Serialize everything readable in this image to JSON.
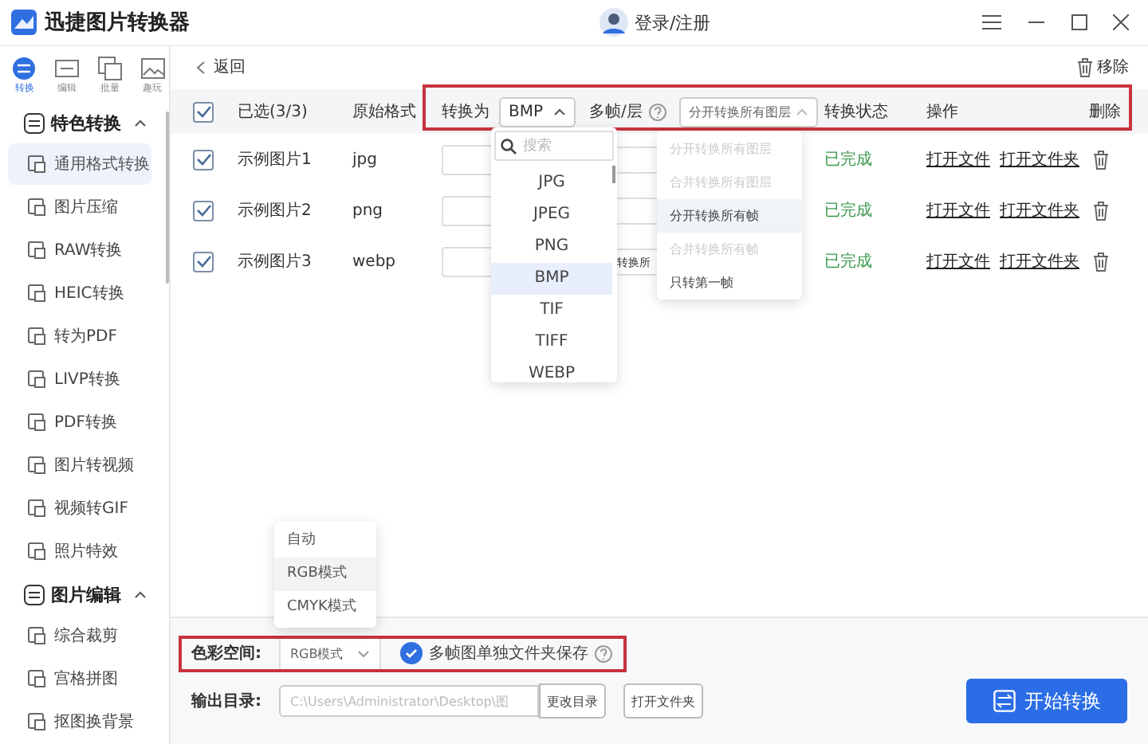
{
  "window": {
    "title": "迅捷图片转换器",
    "login": "登录/注册"
  },
  "sidebar": {
    "modes": [
      {
        "label": "转换",
        "selected": true
      },
      {
        "label": "编辑",
        "selected": false
      },
      {
        "label": "批量",
        "selected": false
      },
      {
        "label": "趣玩",
        "selected": false
      }
    ],
    "sections": [
      {
        "title": "特色转换",
        "expanded": true,
        "items": [
          {
            "label": "通用格式转换",
            "selected": true
          },
          {
            "label": "图片压缩",
            "selected": false
          },
          {
            "label": "RAW转换",
            "selected": false
          },
          {
            "label": "HEIC转换",
            "selected": false
          },
          {
            "label": "转为PDF",
            "selected": false
          },
          {
            "label": "LIVP转换",
            "selected": false
          },
          {
            "label": "PDF转换",
            "selected": false
          },
          {
            "label": "图片转视频",
            "selected": false
          },
          {
            "label": "视频转GIF",
            "selected": false
          },
          {
            "label": "照片特效",
            "selected": false
          }
        ]
      },
      {
        "title": "图片编辑",
        "expanded": true,
        "items": [
          {
            "label": "综合裁剪",
            "selected": false
          },
          {
            "label": "宫格拼图",
            "selected": false
          },
          {
            "label": "抠图换背景",
            "selected": false
          }
        ]
      }
    ]
  },
  "toolbar": {
    "back": "返回",
    "remove": "移除"
  },
  "table": {
    "select_all": {
      "label": "已选(3/3)",
      "checked": true
    },
    "source_format": "原始格式",
    "convert_to": "转换为",
    "target": "BMP",
    "multi_frame": "多帧/层",
    "frame_mode": "分开转换所有图层",
    "status": "转换状态",
    "actions": "操作",
    "delete": "删除",
    "rows": [
      {
        "checked": true,
        "name": "示例图片1",
        "format": "jpg",
        "status": "已完成",
        "open_file": "打开文件",
        "open_folder": "打开文件夹"
      },
      {
        "checked": true,
        "name": "示例图片2",
        "format": "png",
        "status": "已完成",
        "open_file": "打开文件",
        "open_folder": "打开文件夹"
      },
      {
        "checked": true,
        "name": "示例图片3",
        "format": "webp",
        "frame_value": "转换所",
        "status": "已完成",
        "open_file": "打开文件",
        "open_folder": "打开文件夹"
      }
    ]
  },
  "format_menu": {
    "placeholder": "搜索",
    "options": [
      {
        "label": "JPG",
        "selected": false
      },
      {
        "label": "JPEG",
        "selected": false
      },
      {
        "label": "PNG",
        "selected": false
      },
      {
        "label": "BMP",
        "selected": true
      },
      {
        "label": "TIF",
        "selected": false
      },
      {
        "label": "TIFF",
        "selected": false
      },
      {
        "label": "WEBP",
        "selected": false
      }
    ]
  },
  "frame_menu": {
    "options": [
      {
        "label": "分开转换所有图层",
        "disabled": true,
        "selected": false
      },
      {
        "label": "合并转换所有图层",
        "disabled": true,
        "selected": false
      },
      {
        "label": "分开转换所有帧",
        "disabled": false,
        "selected": true
      },
      {
        "label": "合并转换所有帧",
        "disabled": true,
        "selected": false
      },
      {
        "label": "只转第一帧",
        "disabled": false,
        "selected": false
      }
    ]
  },
  "color_menu": {
    "options": [
      {
        "label": "自动",
        "selected": false
      },
      {
        "label": "RGB模式",
        "selected": true
      },
      {
        "label": "CMYK模式",
        "selected": false
      }
    ]
  },
  "settings": {
    "color_space_label": "色彩空间:",
    "color_space": "RGB模式",
    "separate_folder": {
      "label": "多帧图单独文件夹保存",
      "checked": true
    },
    "output_label": "输出目录:",
    "output_path": "C:\\Users\\Administrator\\Desktop\\图",
    "change_dir": "更改目录",
    "open_folder": "打开文件夹",
    "start": "开始转换"
  }
}
